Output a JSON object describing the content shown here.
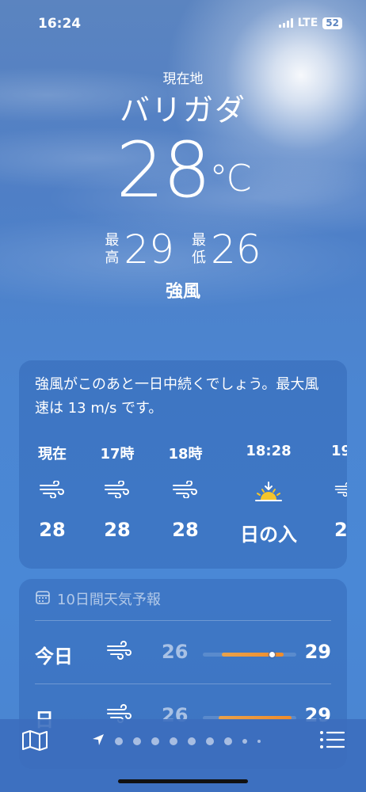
{
  "status": {
    "time": "16:24",
    "network": "LTE",
    "battery": "52"
  },
  "header": {
    "location_label": "現在地",
    "city": "バリガダ",
    "temperature": "28",
    "unit": "°C",
    "high_label": "最高",
    "high": "29",
    "low_label": "最低",
    "low": "26",
    "condition": "強風"
  },
  "hourly": {
    "summary": "強風がこのあと一日中続くでしょう。最大風速は 13 m/s です。",
    "hours": [
      {
        "time": "現在",
        "icon": "wind-icon",
        "value": "28"
      },
      {
        "time": "17時",
        "icon": "wind-icon",
        "value": "28"
      },
      {
        "time": "18時",
        "icon": "wind-icon",
        "value": "28"
      },
      {
        "time": "18:28",
        "icon": "sunset-icon",
        "value": "日の入"
      },
      {
        "time": "19",
        "icon": "wind-icon",
        "value": "2"
      }
    ]
  },
  "ten_day": {
    "title": "10日間天気予報",
    "icon": "calendar-icon",
    "rows": [
      {
        "day": "今日",
        "icon": "wind-icon",
        "low": "26",
        "high": "29"
      },
      {
        "day": "日",
        "icon": "wind-icon",
        "low": "26",
        "high": "29"
      }
    ]
  },
  "bottom_bar": {
    "left_icon": "map-icon",
    "right_icon": "list-icon",
    "location_icon": "location-arrow-icon",
    "page_count": 9,
    "current_page": 0
  },
  "colors": {
    "accent_bar": "#f08c2a",
    "sun": "#f5c52a"
  }
}
